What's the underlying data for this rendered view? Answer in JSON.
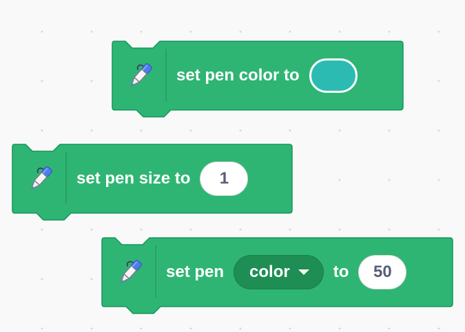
{
  "workspace": {
    "blocks": [
      {
        "category": "pen",
        "icon": "pen-icon",
        "label": "set pen color to",
        "color_value": "#2bbbb3"
      },
      {
        "category": "pen",
        "icon": "pen-icon",
        "label": "set pen size to",
        "size_value": "1"
      },
      {
        "category": "pen",
        "icon": "pen-icon",
        "label_prefix": "set pen",
        "param_option": "color",
        "label_to": "to",
        "param_value": "50"
      }
    ]
  },
  "colors": {
    "block_fill": "#2fb573",
    "block_stroke": "#16945a",
    "dropdown_fill": "#1e8e54",
    "text": "#ffffff",
    "input_text": "#575e75"
  }
}
